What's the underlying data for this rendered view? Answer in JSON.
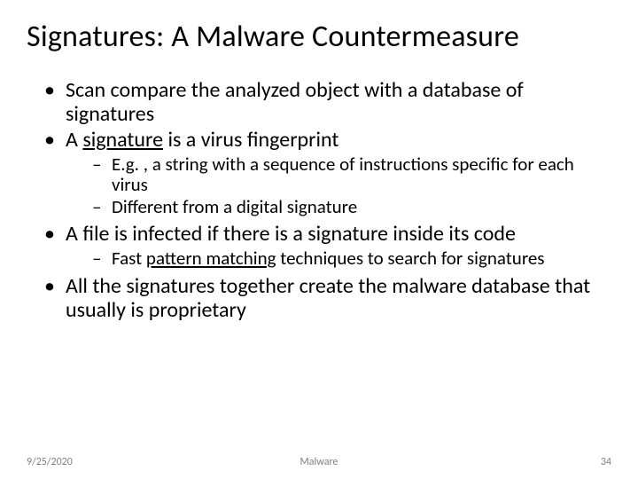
{
  "title": "Signatures: A Malware Countermeasure",
  "bullets": {
    "b1": "Scan compare the analyzed object with a database of signatures",
    "b2_pre": "A ",
    "b2_u": "signature",
    "b2_post": " is a virus fingerprint",
    "b2_sub1": "E.g. , a string with a sequence of instructions specific for each virus",
    "b2_sub2": "Different from a digital signature",
    "b3": "A file is infected if there is a signature inside its code",
    "b3_sub1_pre": "Fast ",
    "b3_sub1_u": "pattern matching",
    "b3_sub1_post": " techniques to search for signatures",
    "b4": "All the signatures together create the malware database that usually is proprietary"
  },
  "footer": {
    "date": "9/25/2020",
    "topic": "Malware",
    "page": "34"
  }
}
